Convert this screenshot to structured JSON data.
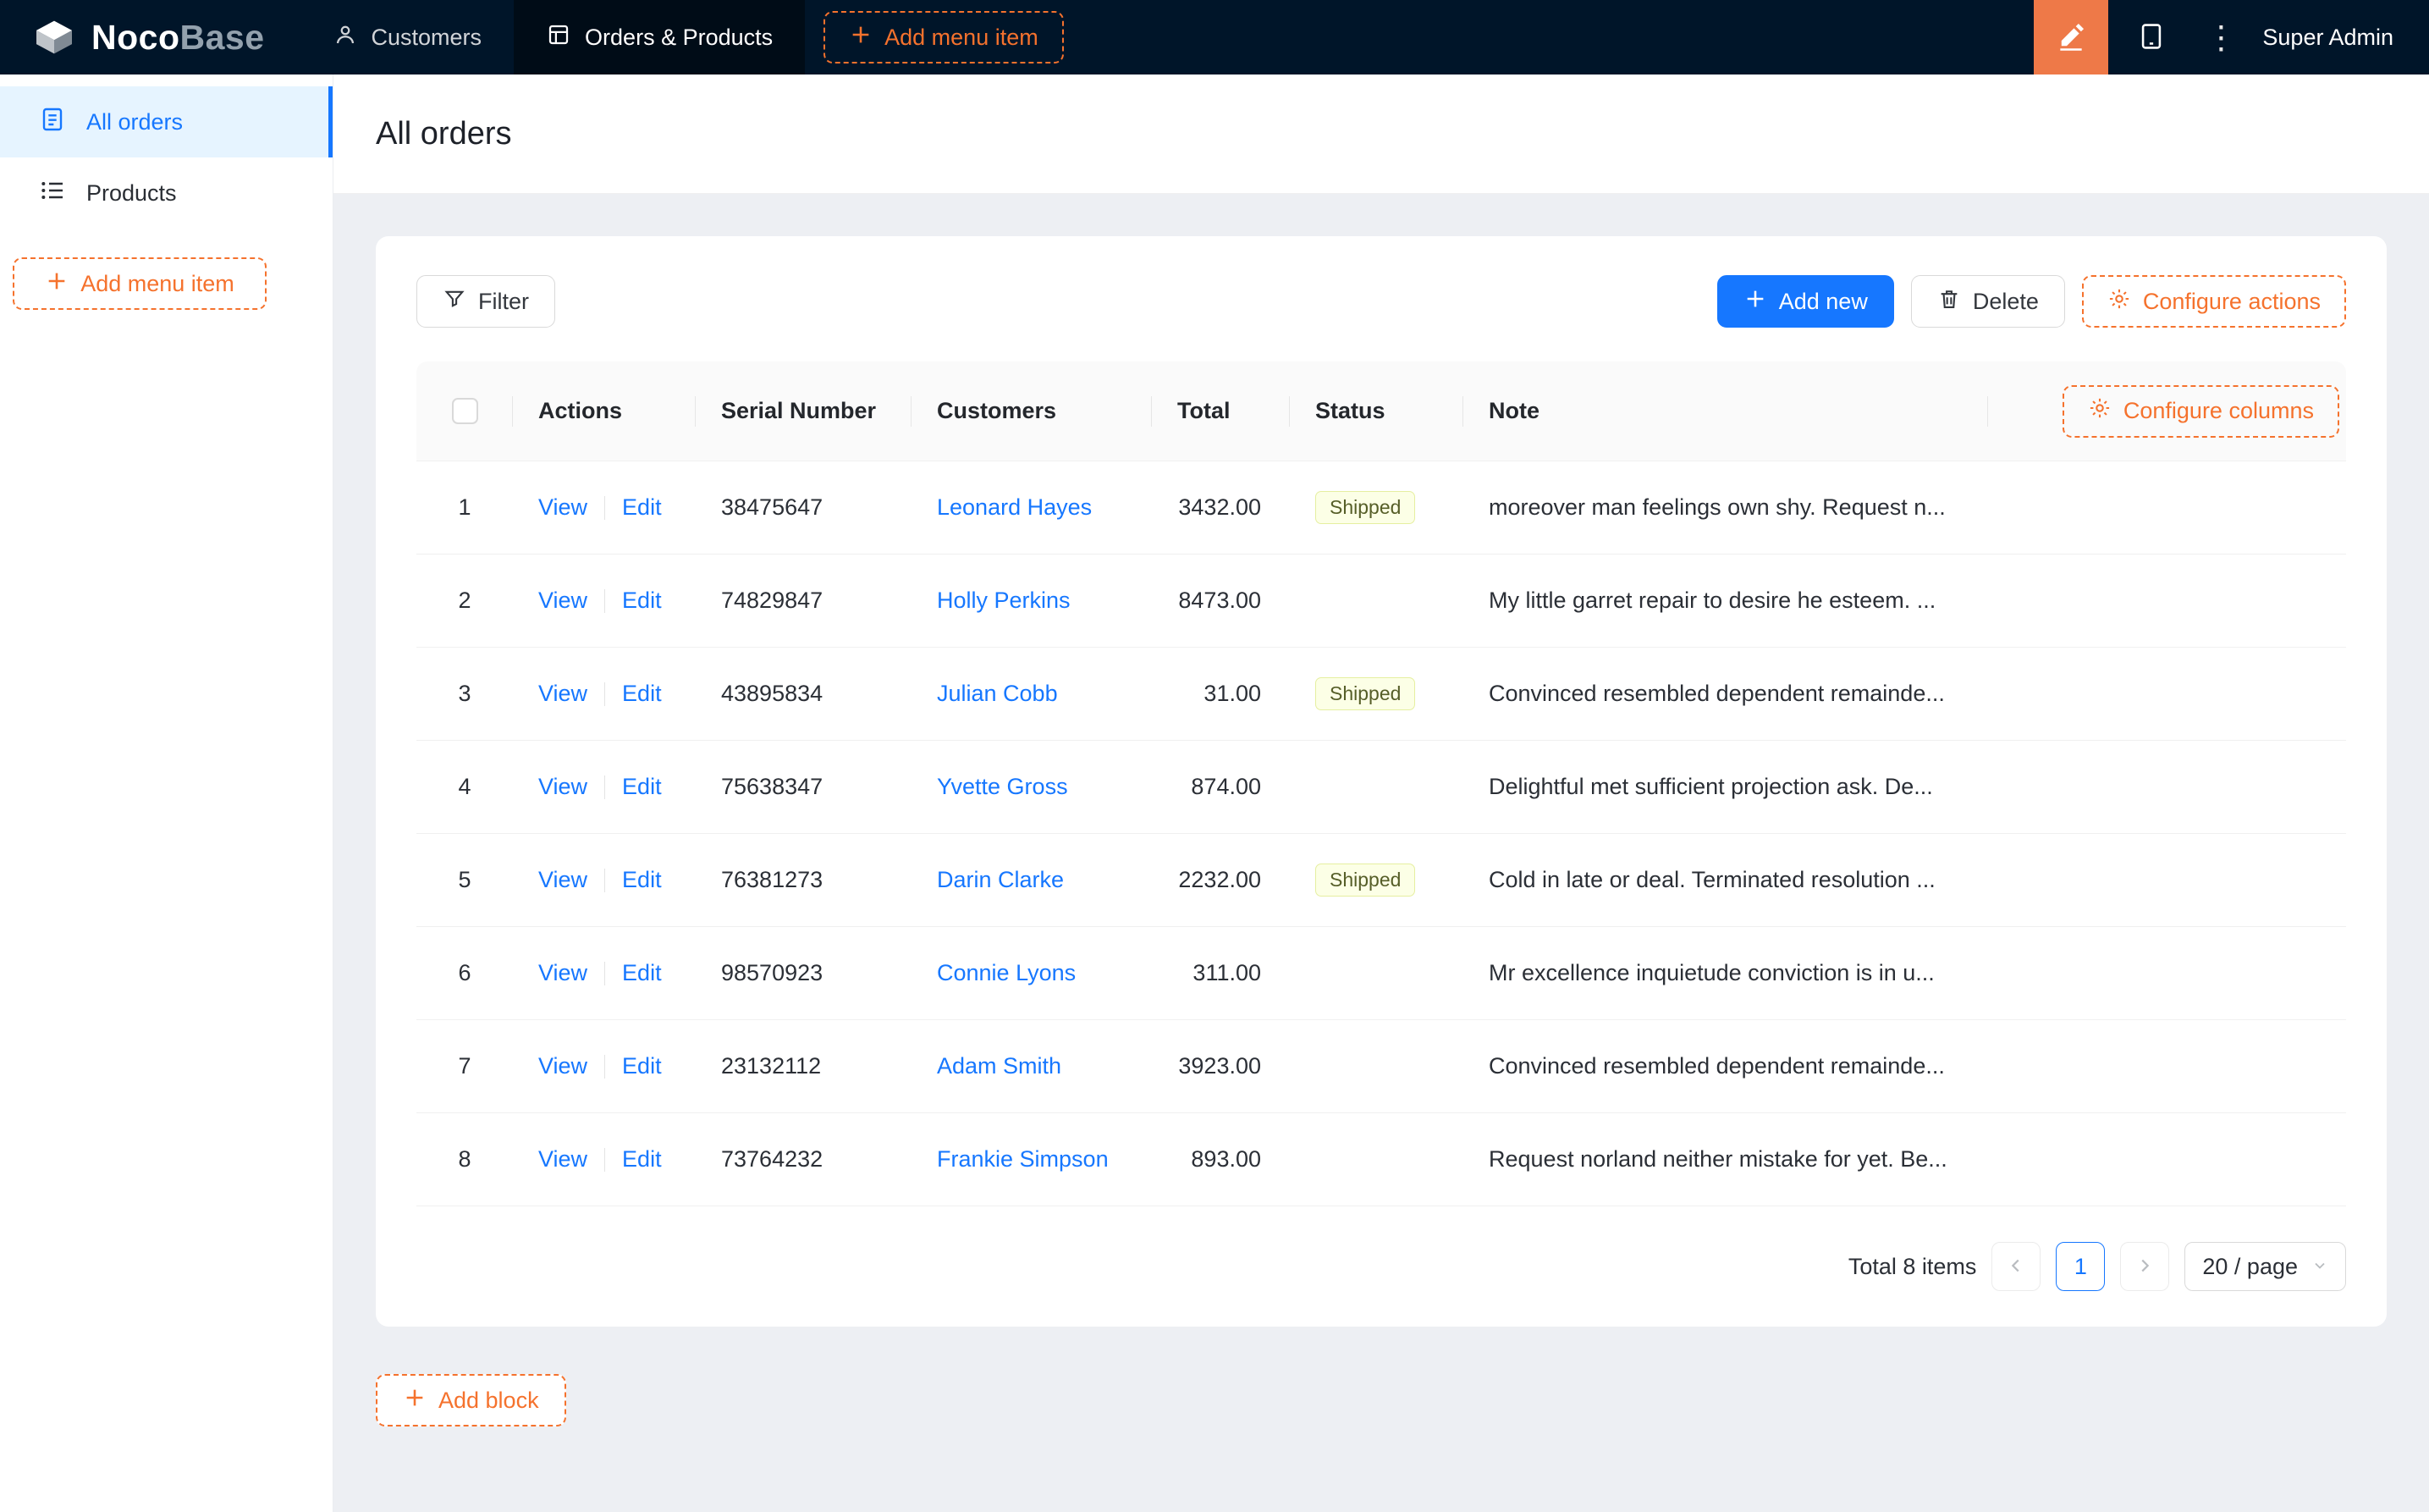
{
  "navbar": {
    "logo_noco": "Noco",
    "logo_base": "Base",
    "items": [
      {
        "label": "Customers"
      },
      {
        "label": "Orders & Products"
      }
    ],
    "add_menu_item": "Add menu item",
    "user": "Super Admin"
  },
  "sidebar": {
    "items": [
      {
        "label": "All orders"
      },
      {
        "label": "Products"
      }
    ],
    "add_menu_item": "Add menu item"
  },
  "page": {
    "title": "All orders"
  },
  "toolbar": {
    "filter": "Filter",
    "add_new": "Add new",
    "delete": "Delete",
    "configure_actions": "Configure actions",
    "configure_columns": "Configure columns"
  },
  "table": {
    "columns": {
      "actions": "Actions",
      "serial": "Serial Number",
      "customers": "Customers",
      "total": "Total",
      "status": "Status",
      "note": "Note"
    },
    "rows": [
      {
        "index": "1",
        "view": "View",
        "edit": "Edit",
        "serial": "38475647",
        "customer": "Leonard Hayes",
        "total": "3432.00",
        "status": "Shipped",
        "note": "moreover man feelings own shy. Request n..."
      },
      {
        "index": "2",
        "view": "View",
        "edit": "Edit",
        "serial": "74829847",
        "customer": "Holly Perkins",
        "total": "8473.00",
        "status": "",
        "note": "My little garret repair to desire he esteem. ..."
      },
      {
        "index": "3",
        "view": "View",
        "edit": "Edit",
        "serial": "43895834",
        "customer": "Julian Cobb",
        "total": "31.00",
        "status": "Shipped",
        "note": "Convinced resembled dependent remainde..."
      },
      {
        "index": "4",
        "view": "View",
        "edit": "Edit",
        "serial": "75638347",
        "customer": "Yvette Gross",
        "total": "874.00",
        "status": "",
        "note": "Delightful met sufficient projection ask. De..."
      },
      {
        "index": "5",
        "view": "View",
        "edit": "Edit",
        "serial": "76381273",
        "customer": "Darin Clarke",
        "total": "2232.00",
        "status": "Shipped",
        "note": "Cold in late or deal. Terminated resolution ..."
      },
      {
        "index": "6",
        "view": "View",
        "edit": "Edit",
        "serial": "98570923",
        "customer": "Connie Lyons",
        "total": "311.00",
        "status": "",
        "note": "Mr excellence inquietude conviction is in u..."
      },
      {
        "index": "7",
        "view": "View",
        "edit": "Edit",
        "serial": "23132112",
        "customer": "Adam Smith",
        "total": "3923.00",
        "status": "",
        "note": "Convinced resembled dependent remainde..."
      },
      {
        "index": "8",
        "view": "View",
        "edit": "Edit",
        "serial": "73764232",
        "customer": "Frankie Simpson",
        "total": "893.00",
        "status": "",
        "note": "Request norland neither mistake for yet. Be..."
      }
    ]
  },
  "pagination": {
    "total_text": "Total 8 items",
    "current_page": "1",
    "page_size": "20 / page"
  },
  "add_block": "Add block",
  "colors": {
    "navbar_bg": "#001529",
    "primary_blue": "#1677ff",
    "accent_orange": "#f5722d",
    "designer_button_bg": "#ee7948",
    "status_tag_bg": "#fcffe6",
    "sidebar_active_bg": "#e6f4ff"
  }
}
